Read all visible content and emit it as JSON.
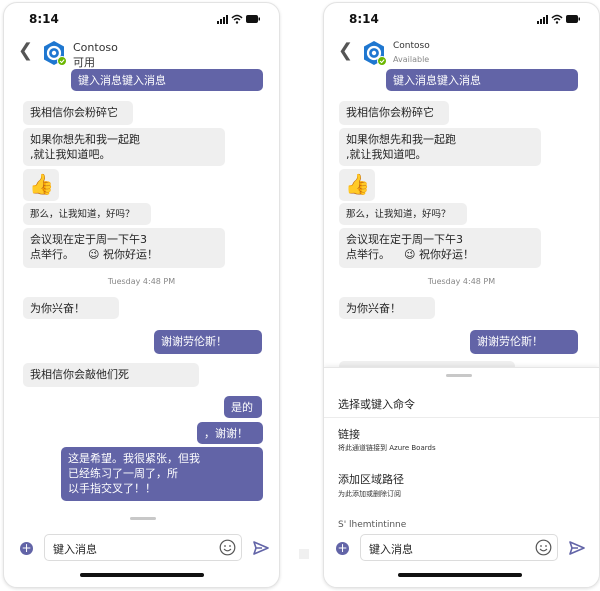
{
  "status_time": "8:14",
  "contact": {
    "name": "Contoso",
    "status_left": "可用",
    "status_right": "Available"
  },
  "messages": {
    "m1": "键入消息键入消息",
    "m2": "我相信你会粉碎它",
    "m3": "如果你想先和我一起跑\n,就让我知道吧。",
    "m4_emoji": "👍",
    "m5": "那么，让我知道，好吗？",
    "m6": "会议现在定于周一下午3\n点举行。    😉 祝你好运！",
    "timestamp": "Tuesday 4:48 PM",
    "m7": "为你兴奋！",
    "m8": "谢谢劳伦斯！",
    "m9": "我相信你会敲他们死",
    "m10": "是的",
    "m11": "，谢谢！",
    "m12": "这是希望。我很紧张，但我\n已经练习了一周了，所\n以手指交叉了！！"
  },
  "composer": {
    "placeholder": "键入消息"
  },
  "command_panel": {
    "title": "选择或键入命令",
    "commands": [
      {
        "title": "链接",
        "desc": "将此通道链接到 Azure Boards"
      },
      {
        "title": "添加区域路径",
        "desc": "为此添加或删除订阅"
      }
    ],
    "partial_item": "S' lhemtintinne"
  },
  "colors": {
    "accent": "#6264a7",
    "incoming_bubble": "#efefef",
    "presence_green": "#6bb700"
  },
  "icons": [
    "back-chevron-icon",
    "contoso-logo-icon",
    "presence-available-icon",
    "signal-icon",
    "wifi-icon",
    "battery-icon",
    "add-icon",
    "emoji-icon",
    "send-icon"
  ]
}
